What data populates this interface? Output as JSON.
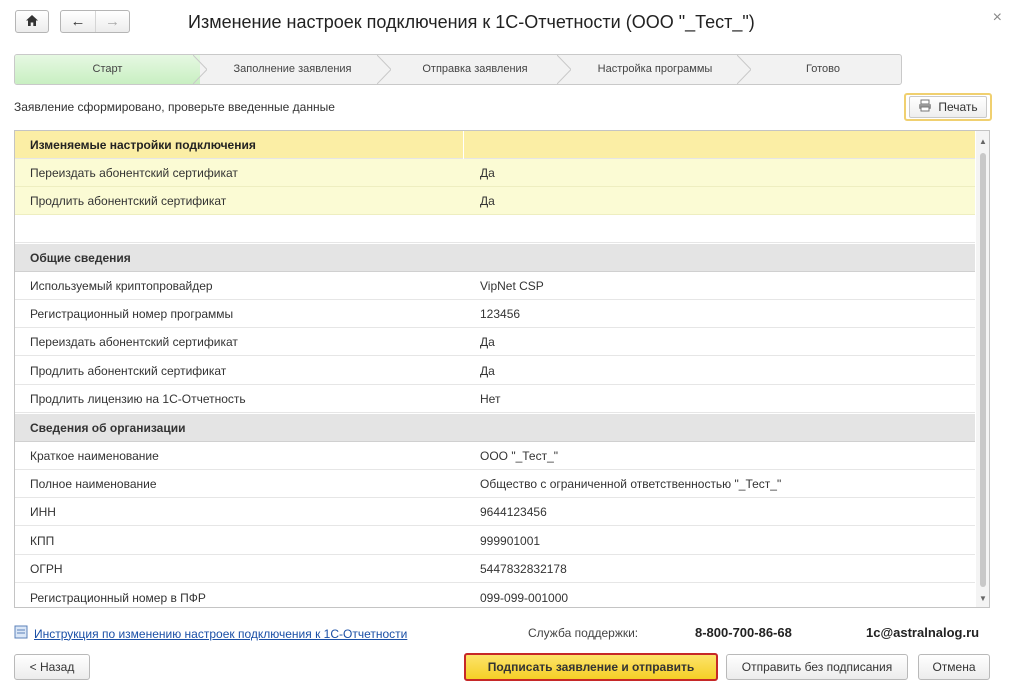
{
  "window": {
    "title": "Изменение настроек подключения к 1С-Отчетности (ООО \"_Тест_\")",
    "close_glyph": "×"
  },
  "nav": {
    "back_glyph": "←",
    "forward_glyph": "→"
  },
  "steps": [
    {
      "label": "Старт",
      "active": true
    },
    {
      "label": "Заполнение заявления",
      "active": false
    },
    {
      "label": "Отправка заявления",
      "active": false
    },
    {
      "label": "Настройка программы",
      "active": false
    },
    {
      "label": "Готово",
      "active": false
    }
  ],
  "info_text": "Заявление сформировано, проверьте введенные данные",
  "print_label": "Печать",
  "table": {
    "changed_header": "Изменяемые настройки подключения",
    "changed_rows": [
      {
        "name": "Переиздать абонентский сертификат",
        "value": "Да"
      },
      {
        "name": "Продлить абонентский сертификат",
        "value": "Да"
      }
    ],
    "general_header": "Общие сведения",
    "general_rows": [
      {
        "name": "Используемый криптопровайдер",
        "value": "VipNet CSP"
      },
      {
        "name": "Регистрационный номер программы",
        "value": "123456"
      },
      {
        "name": "Переиздать абонентский сертификат",
        "value": "Да"
      },
      {
        "name": "Продлить абонентский сертификат",
        "value": "Да"
      },
      {
        "name": "Продлить лицензию на 1С-Отчетность",
        "value": "Нет"
      }
    ],
    "org_header": "Сведения об организации",
    "org_rows": [
      {
        "name": "Краткое наименование",
        "value": "ООО \"_Тест_\""
      },
      {
        "name": "Полное наименование",
        "value": "Общество с ограниченной ответственностью \"_Тест_\""
      },
      {
        "name": "ИНН",
        "value": "9644123456"
      },
      {
        "name": "КПП",
        "value": "999901001"
      },
      {
        "name": "ОГРН",
        "value": "5447832832178"
      },
      {
        "name": "Регистрационный номер в ПФР",
        "value": "099-099-001000"
      }
    ]
  },
  "footer": {
    "instruction_link": "Инструкция по изменению настроек подключения к 1С-Отчетности",
    "support_label": "Служба поддержки:",
    "support_phone": "8-800-700-86-68",
    "support_email": "1c@astralnalog.ru"
  },
  "buttons": {
    "back": "< Назад",
    "sign_and_send": "Подписать заявление и отправить",
    "send_unsigned": "Отправить без подписания",
    "cancel": "Отмена"
  },
  "colors": {
    "active_step": "#d3f3cd",
    "highlight_header": "#fbeea5",
    "highlight_row": "#fbfbd4",
    "group_header": "#e4e4e4",
    "primary_button": "#f7d433",
    "primary_border": "#c62828",
    "link": "#1a4fa6"
  },
  "icons": {
    "home": "home-icon",
    "back": "arrow-left-icon",
    "forward": "arrow-right-icon",
    "close": "close-icon",
    "print": "printer-icon",
    "doc": "document-link-icon"
  }
}
